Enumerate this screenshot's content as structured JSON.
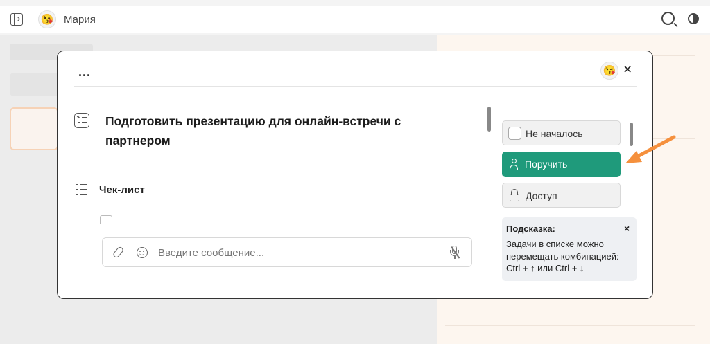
{
  "header": {
    "user_name": "Мария",
    "avatar_emoji": "😘"
  },
  "modal": {
    "menu_label": "...",
    "close_label": "×",
    "avatar_emoji": "😘",
    "task_title": "Подготовить презентацию для онлайн-встречи с партнером",
    "checklist_label": "Чек-лист",
    "composer": {
      "placeholder": "Введите сообщение..."
    },
    "status_label": "Не началось",
    "assign_label": "Поручить",
    "access_label": "Доступ",
    "hint": {
      "title": "Подсказка:",
      "close": "×",
      "text": "Задачи в списке можно перемещать комбинацией: Ctrl + ↑ или Ctrl + ↓"
    }
  },
  "colors": {
    "accent": "#1f9a7b",
    "arrow": "#f5903d"
  },
  "icons": [
    "sidebar-toggle-icon",
    "search-icon",
    "theme-toggle-icon",
    "task-icon",
    "checklist-icon",
    "attach-icon",
    "emoji-icon",
    "mic-off-icon",
    "person-icon",
    "lock-icon",
    "arrow-annotation"
  ]
}
